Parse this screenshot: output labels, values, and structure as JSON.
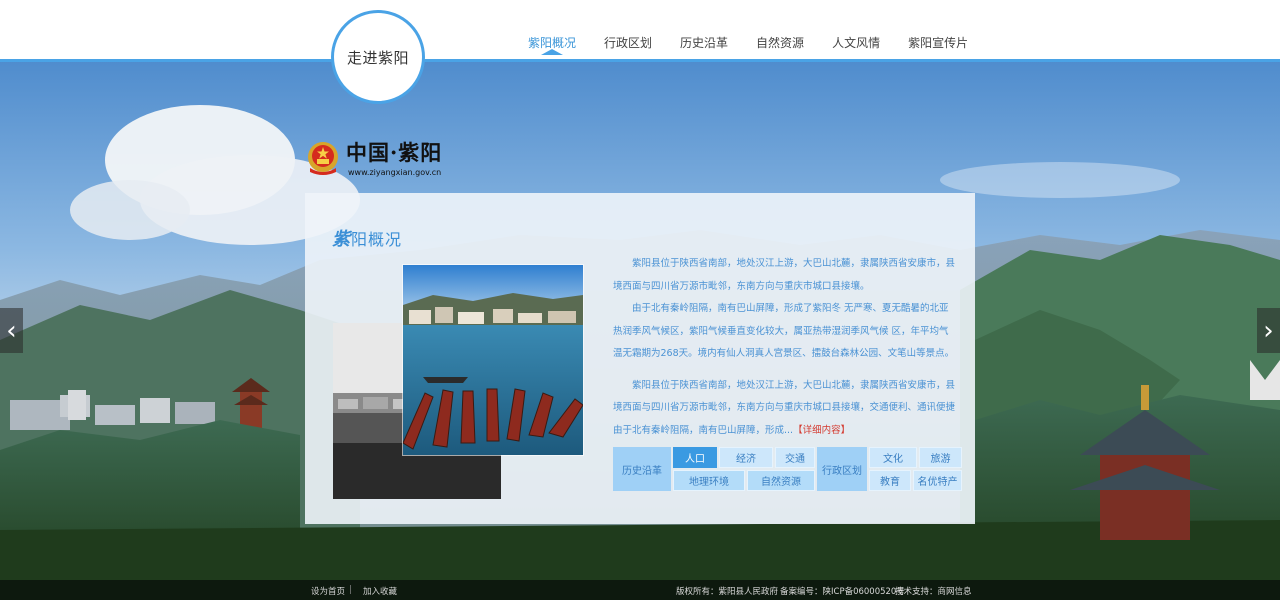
{
  "header": {
    "logo_text": "走进紫阳",
    "nav": [
      {
        "label": "紫阳概况",
        "active": true
      },
      {
        "label": "行政区划",
        "active": false
      },
      {
        "label": "历史沿革",
        "active": false
      },
      {
        "label": "自然资源",
        "active": false
      },
      {
        "label": "人文风情",
        "active": false
      },
      {
        "label": "紫阳宣传片",
        "active": false
      }
    ]
  },
  "brand": {
    "title": "中国·紫阳",
    "url": "www.ziyangxian.gov.cn",
    "emblem_icon": "national-emblem-icon"
  },
  "panel": {
    "title_first_char": "紫",
    "title_rest": "阳概况",
    "paragraphs": [
      "紫阳县位于陕西省南部，地处汉江上游，大巴山北麓，隶属陕西省安康市，县境西面与四川省万源市毗邻，东南方向与重庆市城口县接壤。",
      "由于北有秦岭阻隔，南有巴山屏障，形成了紫阳冬 无严寒、夏无酷暑的北亚热润季风气候区，紫阳气候垂直变化较大，属亚热带湿润季风气候 区，年平均气温无霜期为268天。境内有仙人洞真人宫景区、擂鼓台森林公园、文笔山等景点。",
      "紫阳县位于陕西省南部，地处汉江上游，大巴山北麓，隶属陕西省安康市，县境西面与四川省万源市毗邻，东南方向与重庆市城口县接壤，交通便利、通讯便捷由于北有秦岭阻隔，南有巴山屏障，形成..."
    ],
    "detail_link": "【详细内容】",
    "grid": {
      "group1_title": "历史沿革",
      "group1_items": [
        "人口",
        "经济",
        "交通",
        "地理环境",
        "自然资源"
      ],
      "group2_title": "行政区划",
      "group2_items": [
        "文化",
        "旅游",
        "教育",
        "名优特产"
      ]
    }
  },
  "arrows": {
    "left": "‹",
    "right": "›"
  },
  "footer": {
    "set_home": "设为首页",
    "separator": "|",
    "add_favorite": "加入收藏",
    "copyright": "版权所有：紫阳县人民政府",
    "icp": "备案编号：陕ICP备06000520号",
    "support": "技术支持：商网信息"
  },
  "colors": {
    "accent": "#4aa3e6",
    "text_blue": "#4a92d4",
    "link_red": "#d43a2f",
    "footer_bg": "#0a140c"
  }
}
